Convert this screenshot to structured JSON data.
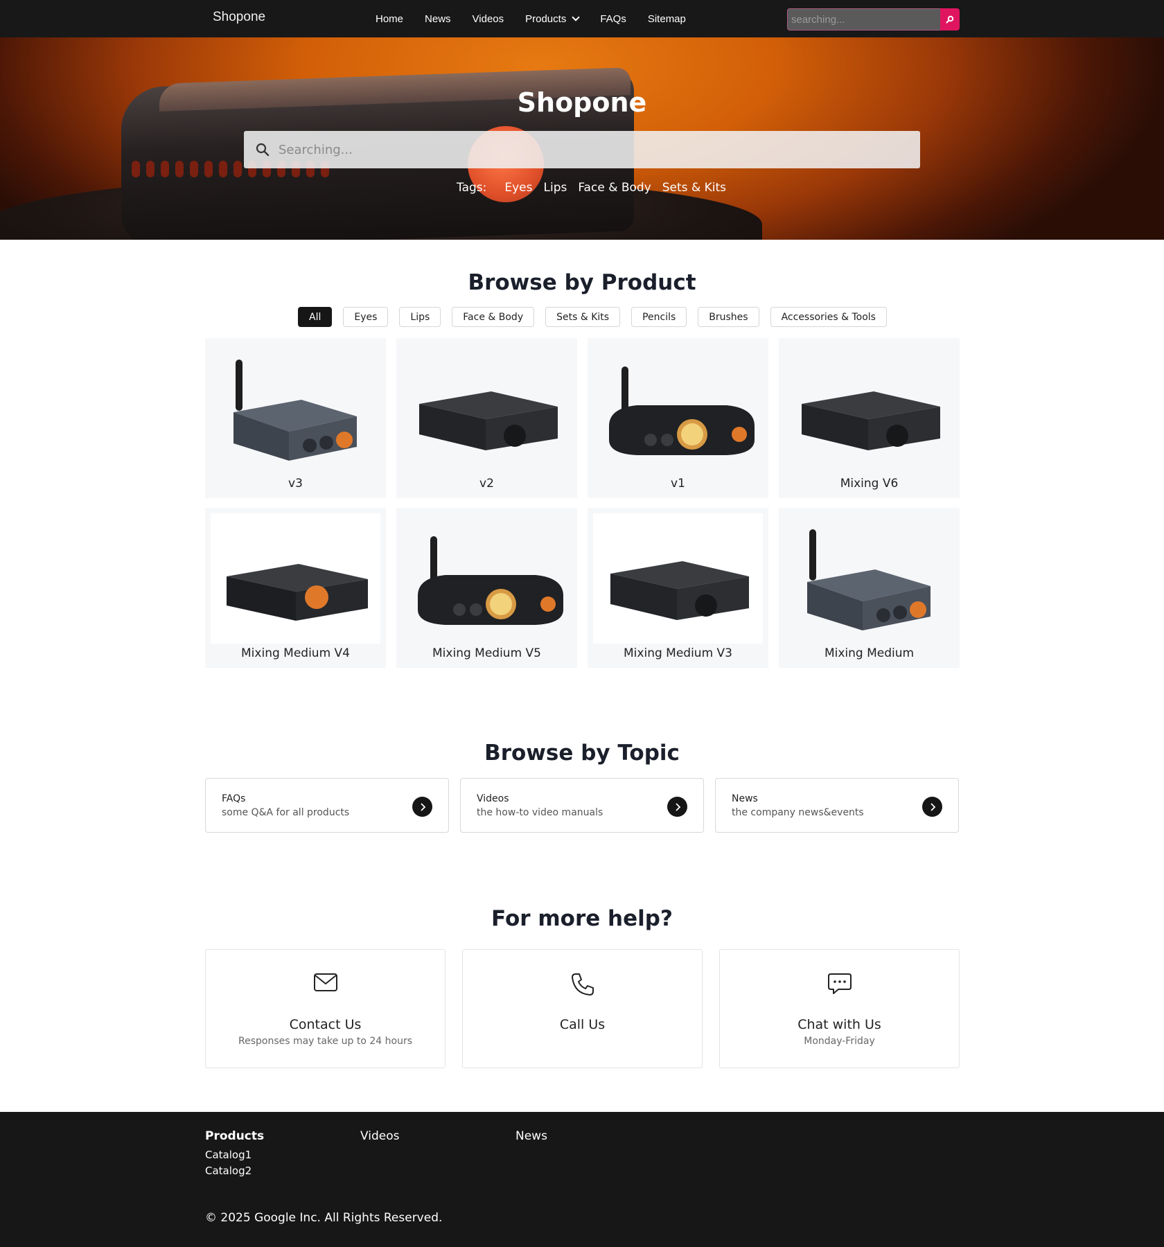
{
  "nav": {
    "brand": "Shopone",
    "links": [
      "Home",
      "News",
      "Videos",
      "Products",
      "FAQs",
      "Sitemap"
    ],
    "search_placeholder": "searching..."
  },
  "hero": {
    "title": "Shopone",
    "search_placeholder": "Searching...",
    "tags_label": "Tags:",
    "tags": [
      "Eyes",
      "Lips",
      "Face & Body",
      "Sets & Kits"
    ]
  },
  "browse_product": {
    "title": "Browse by Product",
    "filters": [
      "All",
      "Eyes",
      "Lips",
      "Face & Body",
      "Sets & Kits",
      "Pencils",
      "Brushes",
      "Accessories & Tools"
    ],
    "active_filter": "All",
    "products": [
      {
        "name": "v3"
      },
      {
        "name": "v2"
      },
      {
        "name": "v1"
      },
      {
        "name": "Mixing V6"
      },
      {
        "name": "Mixing Medium V4"
      },
      {
        "name": "Mixing Medium V5"
      },
      {
        "name": "Mixing Medium V3"
      },
      {
        "name": "Mixing Medium"
      }
    ]
  },
  "browse_topic": {
    "title": "Browse by Topic",
    "topics": [
      {
        "title": "FAQs",
        "desc": "some Q&A for all products"
      },
      {
        "title": "Videos",
        "desc": "the how-to video manuals"
      },
      {
        "title": "News",
        "desc": "the company news&events"
      }
    ]
  },
  "help": {
    "title": "For more help?",
    "cards": [
      {
        "title": "Contact Us",
        "sub": "Responses may take up to 24 hours",
        "icon": "mail-icon"
      },
      {
        "title": "Call Us",
        "sub": "",
        "icon": "phone-icon"
      },
      {
        "title": "Chat with Us",
        "sub": "Monday-Friday",
        "icon": "chat-icon"
      }
    ]
  },
  "footer": {
    "columns": [
      {
        "title": "Products",
        "links": [
          "Catalog1",
          "Catalog2"
        ]
      },
      {
        "title": "Videos",
        "links": []
      },
      {
        "title": "News",
        "links": []
      }
    ],
    "copyright": "© 2025 Google Inc. All Rights Reserved."
  },
  "colors": {
    "accent": "#e0155f",
    "nav_bg": "#181818",
    "footer_bg": "#171717",
    "product_knob": "#e0782a"
  }
}
